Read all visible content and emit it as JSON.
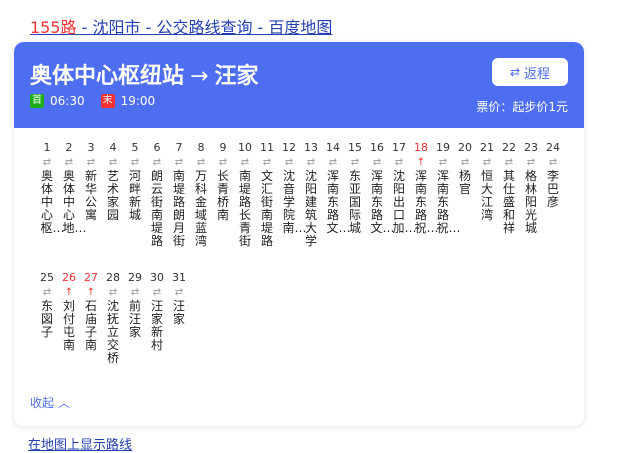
{
  "page": {
    "title_highlight": "155路",
    "title_rest": " - 沈阳市 - 公交路线查询 - 百度地图",
    "map_link": "在地图上显示路线"
  },
  "card": {
    "route_from": "奥体中心枢纽站",
    "route_to": "汪家",
    "arrow": "→",
    "return_label": "返程",
    "first_label": "首",
    "first_time": "06:30",
    "last_label": "末",
    "last_time": "19:00",
    "fare": "票价：起步价1元",
    "collapse_label": "收起"
  },
  "colors": {
    "accent": "#4e6ef2",
    "highlight": "#f73131",
    "first_badge": "#1aad19",
    "link": "#2440b3"
  },
  "stops": [
    {
      "num": "1",
      "dir": "⇄",
      "name": "奥体中心枢…"
    },
    {
      "num": "2",
      "dir": "⇄",
      "name": "奥体中心地…"
    },
    {
      "num": "3",
      "dir": "⇄",
      "name": "新华公寓"
    },
    {
      "num": "4",
      "dir": "⇄",
      "name": "艺术家园"
    },
    {
      "num": "5",
      "dir": "⇄",
      "name": "河畔新城"
    },
    {
      "num": "6",
      "dir": "⇄",
      "name": "朗云街南堤路"
    },
    {
      "num": "7",
      "dir": "⇄",
      "name": "南堤路朗月街"
    },
    {
      "num": "8",
      "dir": "⇄",
      "name": "万科金域蓝湾"
    },
    {
      "num": "9",
      "dir": "⇄",
      "name": "长青桥南"
    },
    {
      "num": "10",
      "dir": "⇄",
      "name": "南堤路长青街"
    },
    {
      "num": "11",
      "dir": "⇄",
      "name": "文汇街南堤路"
    },
    {
      "num": "12",
      "dir": "⇄",
      "name": "沈音学院南…"
    },
    {
      "num": "13",
      "dir": "⇄",
      "name": "沈阳建筑大学"
    },
    {
      "num": "14",
      "dir": "⇄",
      "name": "浑南东路文…"
    },
    {
      "num": "15",
      "dir": "⇄",
      "name": "东亚国际城"
    },
    {
      "num": "16",
      "dir": "⇄",
      "name": "浑南东路文…"
    },
    {
      "num": "17",
      "dir": "⇄",
      "name": "沈阳出口加…"
    },
    {
      "num": "18",
      "dir": "↑",
      "name": "浑南东路祝…",
      "red": true
    },
    {
      "num": "19",
      "dir": "⇄",
      "name": "浑南东路祝…"
    },
    {
      "num": "20",
      "dir": "⇄",
      "name": "杨官"
    },
    {
      "num": "21",
      "dir": "⇄",
      "name": "恒大江湾"
    },
    {
      "num": "22",
      "dir": "⇄",
      "name": "其仕盛和祥"
    },
    {
      "num": "23",
      "dir": "⇄",
      "name": "格林阳光城"
    },
    {
      "num": "24",
      "dir": "⇄",
      "name": "李巴彦"
    },
    {
      "num": "25",
      "dir": "⇄",
      "name": "东図子"
    },
    {
      "num": "26",
      "dir": "↑",
      "name": "刘付屯南",
      "red": true
    },
    {
      "num": "27",
      "dir": "↑",
      "name": "石庙子南",
      "red": true
    },
    {
      "num": "28",
      "dir": "⇄",
      "name": "沈抚立交桥"
    },
    {
      "num": "29",
      "dir": "⇄",
      "name": "前汪家"
    },
    {
      "num": "30",
      "dir": "⇄",
      "name": "汪家新村"
    },
    {
      "num": "31",
      "dir": "⇄",
      "name": "汪家"
    }
  ]
}
